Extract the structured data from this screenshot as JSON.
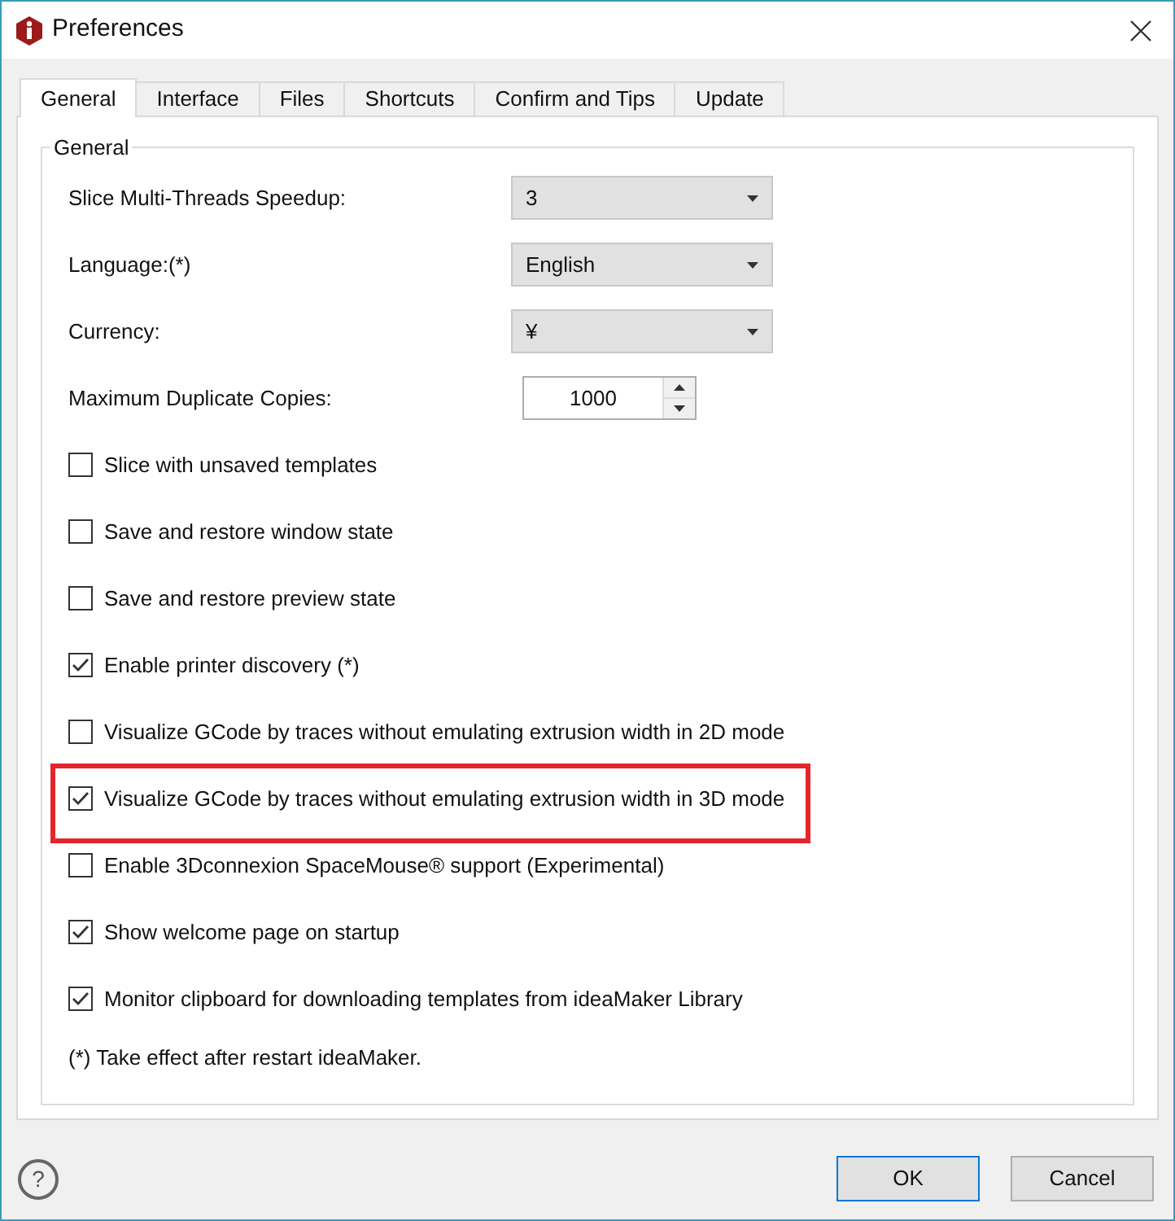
{
  "window": {
    "title": "Preferences"
  },
  "tabs": [
    {
      "label": "General",
      "selected": true
    },
    {
      "label": "Interface",
      "selected": false
    },
    {
      "label": "Files",
      "selected": false
    },
    {
      "label": "Shortcuts",
      "selected": false
    },
    {
      "label": "Confirm and Tips",
      "selected": false
    },
    {
      "label": "Update",
      "selected": false
    }
  ],
  "group": {
    "title": "General"
  },
  "settings": [
    {
      "kind": "select",
      "label": "Slice Multi-Threads Speedup:",
      "value": "3"
    },
    {
      "kind": "select",
      "label": "Language:(*)",
      "value": "English"
    },
    {
      "kind": "select",
      "label": "Currency:",
      "value": "¥"
    },
    {
      "kind": "spin",
      "label": "Maximum Duplicate Copies:",
      "value": "1000"
    },
    {
      "kind": "checkbox",
      "label": "Slice with unsaved templates",
      "checked": false,
      "highlighted": false
    },
    {
      "kind": "checkbox",
      "label": "Save and restore window state",
      "checked": false,
      "highlighted": false
    },
    {
      "kind": "checkbox",
      "label": "Save and restore preview state",
      "checked": false,
      "highlighted": false
    },
    {
      "kind": "checkbox",
      "label": "Enable printer discovery (*)",
      "checked": true,
      "highlighted": false
    },
    {
      "kind": "checkbox",
      "label": "Visualize GCode by traces without emulating extrusion width in 2D mode",
      "checked": false,
      "highlighted": false
    },
    {
      "kind": "checkbox",
      "label": "Visualize GCode by traces without emulating extrusion width in 3D mode",
      "checked": true,
      "highlighted": true
    },
    {
      "kind": "checkbox",
      "label": "Enable 3Dconnexion SpaceMouse® support (Experimental)",
      "checked": false,
      "highlighted": false
    },
    {
      "kind": "checkbox",
      "label": "Show welcome page on startup",
      "checked": true,
      "highlighted": false
    },
    {
      "kind": "checkbox",
      "label": "Monitor clipboard for downloading templates from ideaMaker Library",
      "checked": true,
      "highlighted": false
    }
  ],
  "note": "(*) Take effect after restart ideaMaker.",
  "buttons": [
    {
      "label": "OK",
      "selected": true
    },
    {
      "label": "Cancel",
      "selected": false
    }
  ],
  "help": "?"
}
